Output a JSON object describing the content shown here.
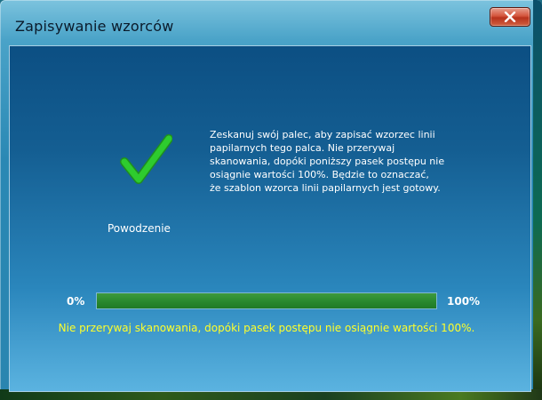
{
  "window": {
    "title": "Zapisywanie wzorców",
    "close_label": "Zamknij"
  },
  "status": {
    "text": "Powodzenie",
    "icon": "checkmark-icon",
    "color": "#2ecc2e"
  },
  "instructions": {
    "lines": [
      "Zeskanuj swój palec, aby zapisać wzorzec linii",
      "papilarnych tego palca.  Nie przerywaj",
      "skanowania, dopóki poniższy pasek postępu nie",
      "osiągnie wartości 100%.  Będzie to oznaczać,",
      "że szablon wzorca linii papilarnych jest gotowy."
    ]
  },
  "progress": {
    "start_label": "0%",
    "end_label": "100%",
    "value_percent": 100,
    "fill_color": "#2a8a30"
  },
  "warning": {
    "text": "Nie przerywaj skanowania, dopóki pasek postępu nie osiągnie wartości 100%.",
    "color": "#ffff2a"
  }
}
